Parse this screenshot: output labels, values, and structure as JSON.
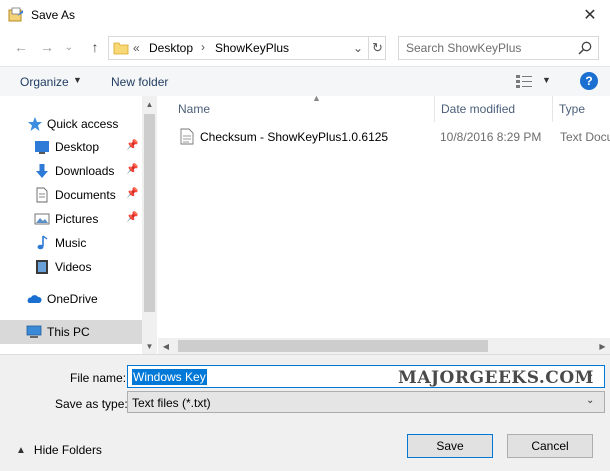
{
  "window": {
    "title": "Save As"
  },
  "address": {
    "overflow": "«",
    "crumbs": [
      "Desktop",
      "ShowKeyPlus"
    ]
  },
  "search": {
    "placeholder": "Search ShowKeyPlus"
  },
  "toolbar": {
    "organize": "Organize",
    "new_folder": "New folder"
  },
  "nav": {
    "items": [
      {
        "label": "Quick access",
        "icon": "star-icon"
      },
      {
        "label": "Desktop",
        "icon": "desktop-icon",
        "pinned": true
      },
      {
        "label": "Downloads",
        "icon": "download-icon",
        "pinned": true
      },
      {
        "label": "Documents",
        "icon": "document-icon",
        "pinned": true
      },
      {
        "label": "Pictures",
        "icon": "picture-icon",
        "pinned": true
      },
      {
        "label": "Music",
        "icon": "music-icon"
      },
      {
        "label": "Videos",
        "icon": "video-icon"
      },
      {
        "label": "OneDrive",
        "icon": "cloud-icon"
      },
      {
        "label": "This PC",
        "icon": "computer-icon",
        "selected": true
      }
    ]
  },
  "columns": {
    "name": "Name",
    "date": "Date modified",
    "type": "Type"
  },
  "files": [
    {
      "name": "Checksum - ShowKeyPlus1.0.6125",
      "date": "10/8/2016 8:29 PM",
      "type": "Text Docu"
    }
  ],
  "fields": {
    "filename_label": "File name:",
    "filename_value": "Windows Key",
    "saveas_label": "Save as type:",
    "saveas_value": "Text files (*.txt)"
  },
  "watermark": "MAJORGEEKS.COM",
  "buttons": {
    "hide_folders": "Hide Folders",
    "save": "Save",
    "cancel": "Cancel"
  },
  "colors": {
    "accent": "#0078d7",
    "help": "#1a6fd1",
    "selection": "#d9d9d9"
  }
}
